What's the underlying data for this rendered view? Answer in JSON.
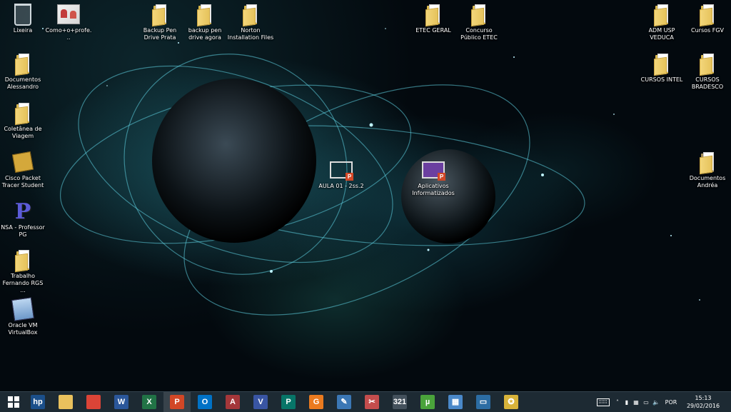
{
  "desktop": {
    "icons": [
      {
        "id": "lixeira",
        "label": "Lixeira"
      },
      {
        "id": "como",
        "label": "Como+o+profe..."
      },
      {
        "id": "backup-prata",
        "label": "Backup Pen Drive Prata"
      },
      {
        "id": "backup-agora",
        "label": "backup pen drive agora"
      },
      {
        "id": "norton",
        "label": "Norton Installation Files"
      },
      {
        "id": "etec-geral",
        "label": "ETEC GERAL"
      },
      {
        "id": "concurso",
        "label": "Concurso Público ETEC"
      },
      {
        "id": "adm-usp",
        "label": "ADM USP VEDUCA"
      },
      {
        "id": "cursos-fgv",
        "label": "Cursos FGV"
      },
      {
        "id": "documentos-alessandro",
        "label": "Documentos Alessandro"
      },
      {
        "id": "cursos-intel",
        "label": "CURSOS INTEL"
      },
      {
        "id": "cursos-bradesco",
        "label": "CURSOS BRADESCO"
      },
      {
        "id": "coletanea",
        "label": "Coletânea de Viagem"
      },
      {
        "id": "cisco",
        "label": "Cisco Packet Tracer Student"
      },
      {
        "id": "aula01",
        "label": "AULA 01 - 2ss.2"
      },
      {
        "id": "aplicativos",
        "label": "Aplicativos Informatizados"
      },
      {
        "id": "documentos-andrea",
        "label": "Documentos Andréa"
      },
      {
        "id": "nsa",
        "label": "NSA - Professor PG"
      },
      {
        "id": "trabalho",
        "label": "Trabalho Fernando RGS ..."
      },
      {
        "id": "virtualbox",
        "label": "Oracle VM VirtualBox"
      }
    ]
  },
  "taskbar": {
    "start_icon": "windows-logo-icon",
    "apps": [
      {
        "name": "hp",
        "glyph": "hp",
        "color": "#1b4f8a"
      },
      {
        "name": "file-explorer",
        "glyph": "",
        "color": "#e9c15d"
      },
      {
        "name": "chrome",
        "glyph": "",
        "color": "#db4437"
      },
      {
        "name": "word",
        "glyph": "W",
        "color": "#2b579a"
      },
      {
        "name": "excel",
        "glyph": "X",
        "color": "#217346"
      },
      {
        "name": "powerpoint",
        "glyph": "P",
        "color": "#d24726"
      },
      {
        "name": "outlook",
        "glyph": "O",
        "color": "#0072c6"
      },
      {
        "name": "access",
        "glyph": "A",
        "color": "#a4373a"
      },
      {
        "name": "visio",
        "glyph": "V",
        "color": "#3955a3"
      },
      {
        "name": "publisher",
        "glyph": "P",
        "color": "#077568"
      },
      {
        "name": "office-orange",
        "glyph": "G",
        "color": "#ea7a1f"
      },
      {
        "name": "paint-tool",
        "glyph": "✎",
        "color": "#3b77b5"
      },
      {
        "name": "snipping-tool",
        "glyph": "✂",
        "color": "#c44d4d"
      },
      {
        "name": "calendar-321",
        "glyph": "321",
        "color": "#44515c"
      },
      {
        "name": "utorrent",
        "glyph": "µ",
        "color": "#4aa33b"
      },
      {
        "name": "calculator",
        "glyph": "▦",
        "color": "#4a88c9"
      },
      {
        "name": "monitor",
        "glyph": "▭",
        "color": "#2c6da4"
      },
      {
        "name": "dictionary-tool",
        "glyph": "✪",
        "color": "#d8b33a"
      }
    ],
    "tray": {
      "language": "POR",
      "time": "15:13",
      "date": "29/02/2016"
    }
  }
}
